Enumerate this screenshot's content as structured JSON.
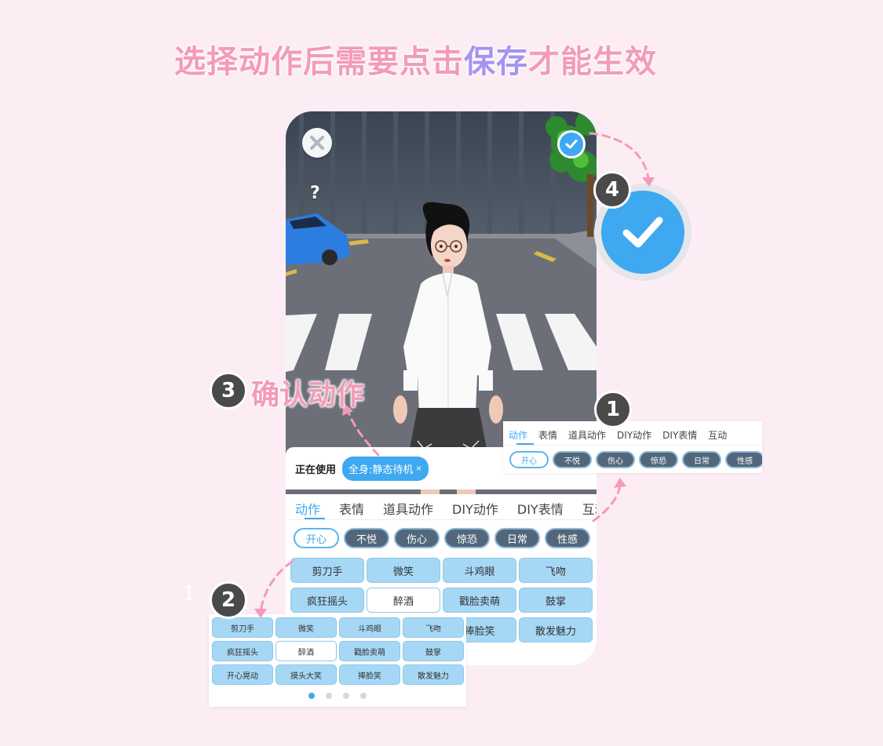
{
  "headline": {
    "part1": "选择动作后需要点击",
    "highlight": "保存",
    "part2": "才能生效"
  },
  "phone": {
    "close_icon": "close-icon",
    "save_icon": "checkmark-icon",
    "help_text": "?",
    "using": {
      "label": "正在使用",
      "chip": "全身:静态待机",
      "chip_x": "×"
    },
    "tabs": [
      "动作",
      "表情",
      "道具动作",
      "DIY动作",
      "DIY表情",
      "互动"
    ],
    "categories": [
      "开心",
      "不悦",
      "伤心",
      "惊恐",
      "日常",
      "性感"
    ],
    "actions": [
      "剪刀手",
      "微笑",
      "斗鸡眼",
      "飞吻",
      "疯狂摇头",
      "醉酒",
      "戳脸卖萌",
      "鼓掌",
      "开心晃动",
      "摸头大笑",
      "捧脸笑",
      "散发魅力"
    ],
    "selected_action": "醉酒",
    "page_dots": 4,
    "active_dot": 0
  },
  "annotations": {
    "step1": "1",
    "step2": "2",
    "step3": "3",
    "step4": "4",
    "confirm_label": "确认动作",
    "stray_digit": "1"
  },
  "colors": {
    "accent": "#3ea8f0",
    "pink": "#f39bb7",
    "purple": "#a394f2",
    "background": "#fcedf4"
  }
}
